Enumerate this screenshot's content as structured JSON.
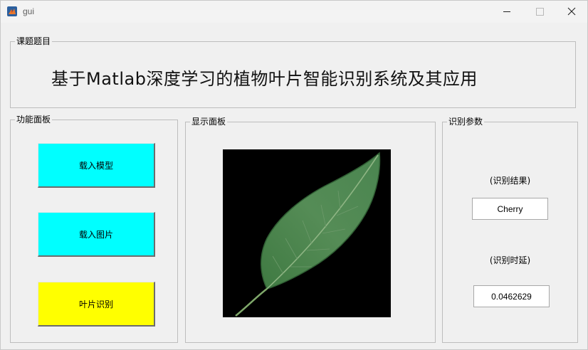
{
  "window": {
    "title": "gui",
    "icon": "matlab-icon",
    "controls": [
      "minimize-icon",
      "maximize-icon",
      "close-icon"
    ]
  },
  "topic_panel": {
    "label": "课题题目",
    "heading": "基于Matlab深度学习的植物叶片智能识别系统及其应用"
  },
  "function_panel": {
    "label": "功能面板",
    "buttons": [
      {
        "label": "载入模型",
        "color": "#00ffff"
      },
      {
        "label": "载入图片",
        "color": "#00ffff"
      },
      {
        "label": "叶片识别",
        "color": "#ffff00"
      }
    ]
  },
  "display_panel": {
    "label": "显示面板",
    "image": "green-leaf-on-black"
  },
  "params_panel": {
    "label": "识别参数",
    "result_label": "(识别结果)",
    "result_value": "Cherry",
    "latency_label": "(识别时延)",
    "latency_value": "0.0462629"
  }
}
